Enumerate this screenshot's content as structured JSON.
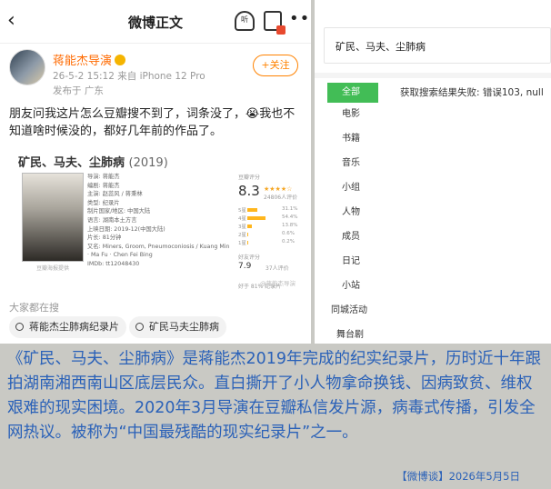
{
  "weibo": {
    "title": "微博正文",
    "listen_label": "听",
    "username": "蒋能杰导演",
    "meta": "26-5-2 15:12  来自 iPhone 12 Pro",
    "place": "发布于 广东",
    "follow_label": "+关注",
    "post_text": "朋友问我这片怎么豆瓣搜不到了，词条没了，😭我也不知道啥时候没的，都好几年前的作品了。",
    "card": {
      "title": "矿民、马夫、尘肺病",
      "year": "(2019)",
      "poster_caption": "豆瓣海报提供",
      "info": [
        "导演: 蒋能杰",
        "编剧: 蒋能杰",
        "主演: 赵蕊风 / 蒋秉林",
        "类型: 纪录片",
        "制片国家/地区: 中国大陆",
        "语言: 湖南本土方言",
        "上映日期: 2019-12(中国大陆)",
        "片长: 81分钟",
        "又名: Miners, Groom, Pneumoconiosis / Kuang Min · Ma Fu · Chen Fei Bing",
        "IMDb: tt12048430"
      ],
      "rating_label": "豆瓣评分",
      "score": "8.3",
      "stars": "★★★★☆",
      "votes": "24806人评价",
      "bars": [
        {
          "label": "5星",
          "pct": "31.1%",
          "value": 0.311
        },
        {
          "label": "4星",
          "pct": "54.4%",
          "value": 0.544
        },
        {
          "label": "3星",
          "pct": "13.8%",
          "value": 0.138
        },
        {
          "label": "2星",
          "pct": "0.6%",
          "value": 0.006
        },
        {
          "label": "1星",
          "pct": "0.2%",
          "value": 0.002
        }
      ],
      "better_label": "好友评分",
      "small_score": "7.9",
      "review_count": "37人评价",
      "better_than": "好于 81% 纪录片",
      "watermark": "@蒋能杰导演"
    },
    "search_label": "大家都在搜",
    "chips": [
      "蒋能杰尘肺病纪录片",
      "矿民马夫尘肺病"
    ]
  },
  "douban": {
    "search_text": "矿民、马夫、尘肺病",
    "nav": [
      "全部",
      "电影",
      "书籍",
      "音乐",
      "小组",
      "人物",
      "成员",
      "日记",
      "小站",
      "同城活动",
      "舞台剧"
    ],
    "active_nav": "全部",
    "error_text": "获取搜索结果失败: 错误103, null"
  },
  "caption": "《矿民、马夫、尘肺病》是蒋能杰2019年完成的纪实纪录片，历时近十年跟拍湖南湘西南山区底层民众。直白撕开了小人物拿命换钱、因病致贫、维权艰难的现实困境。2020年3月导演在豆瓣私信发片源，病毒式传播，引发全网热议。被称为“中国最残酷的现实纪录片”之一。",
  "footer": "【微博谈】2026年5月5日"
}
